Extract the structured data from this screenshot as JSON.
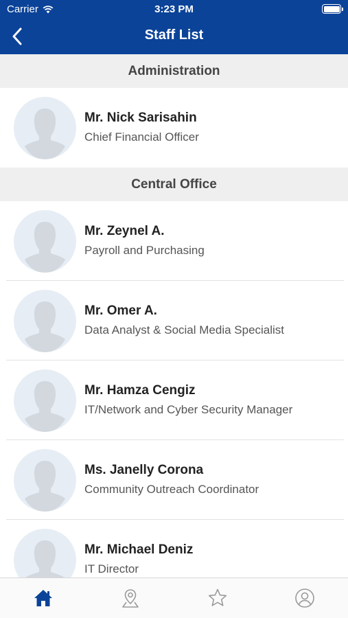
{
  "status": {
    "carrier": "Carrier",
    "time": "3:23 PM"
  },
  "header": {
    "title": "Staff List",
    "back_icon": "chevron-left-icon"
  },
  "sections": [
    {
      "title": "Administration",
      "staff": [
        {
          "name": "Mr. Nick Sarisahin",
          "role": "Chief Financial Officer"
        }
      ]
    },
    {
      "title": "Central Office",
      "staff": [
        {
          "name": "Mr. Zeynel A.",
          "role": "Payroll and Purchasing"
        },
        {
          "name": "Mr. Omer A.",
          "role": "Data Analyst & Social Media Specialist"
        },
        {
          "name": "Mr. Hamza Cengiz",
          "role": "IT/Network and Cyber Security Manager"
        },
        {
          "name": "Ms. Janelly Corona",
          "role": "Community Outreach Coordinator"
        },
        {
          "name": "Mr. Michael Deniz",
          "role": "IT Director"
        }
      ]
    }
  ],
  "tabbar": {
    "tabs": [
      {
        "icon": "home-icon",
        "active": true
      },
      {
        "icon": "map-pin-icon",
        "active": false
      },
      {
        "icon": "star-icon",
        "active": false
      },
      {
        "icon": "profile-icon",
        "active": false
      }
    ]
  },
  "colors": {
    "brand": "#0b4398",
    "section_bg": "#efefef",
    "avatar_bg": "#e6edf5",
    "tab_inactive": "#9a9a9a"
  }
}
